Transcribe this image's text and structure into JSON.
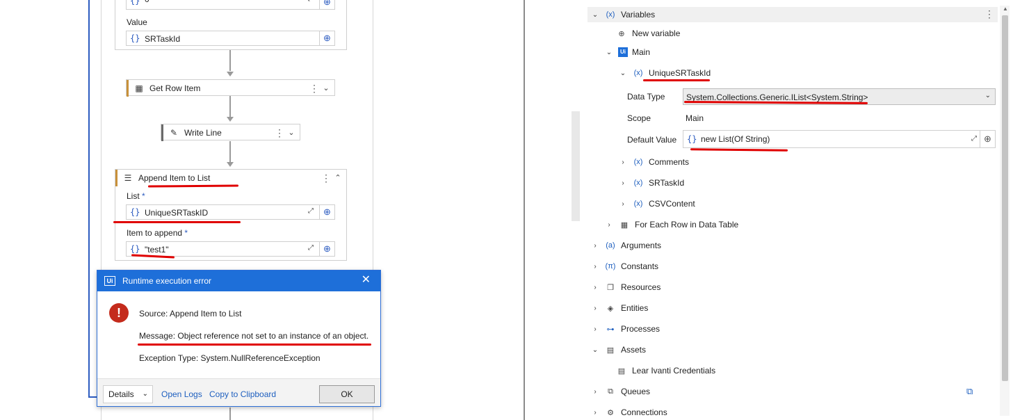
{
  "designer": {
    "top_field": {
      "value": "0"
    },
    "value_label": "Value",
    "value_field": {
      "brace": "{}",
      "value": "SRTaskId"
    },
    "get_row_item": {
      "title": "Get Row Item"
    },
    "write_line": {
      "title": "Write Line"
    },
    "append_item": {
      "title": "Append Item to List",
      "list_label": "List",
      "list_required": "*",
      "list_value": "UniqueSRTaskID",
      "item_label": "Item to append",
      "item_required": "*",
      "item_value": "\"test1\""
    }
  },
  "dialog": {
    "title": "Runtime execution error",
    "source": "Source: Append Item to List",
    "message": "Message: Object reference not set to an instance of an object.",
    "exception": "Exception Type: System.NullReferenceException",
    "details_button": "Details",
    "open_logs": "Open Logs",
    "copy_clipboard": "Copy to Clipboard",
    "ok_button": "OK"
  },
  "panel": {
    "variables": "Variables",
    "new_variable": "New variable",
    "main": "Main",
    "variable_name": "UniqueSRTaskId",
    "data_type_label": "Data Type",
    "data_type_value": "System.Collections.Generic.IList<System.String>",
    "scope_label": "Scope",
    "scope_value": "Main",
    "default_value_label": "Default Value",
    "default_value": "new List(Of String)",
    "other_vars": [
      "Comments",
      "SRTaskId",
      "CSVContent"
    ],
    "for_each_row": "For Each Row in Data Table",
    "arguments": "Arguments",
    "constants": "Constants",
    "resources": "Resources",
    "entities": "Entities",
    "processes": "Processes",
    "assets": "Assets",
    "asset_item": "Lear Ivanti Credentials",
    "queues": "Queues",
    "connections": "Connections"
  },
  "colors": {
    "accent_blue": "#1e6fd9",
    "annotation_red": "#e00000",
    "error_red": "#c42b1c",
    "activity_border": "#c8913a"
  }
}
